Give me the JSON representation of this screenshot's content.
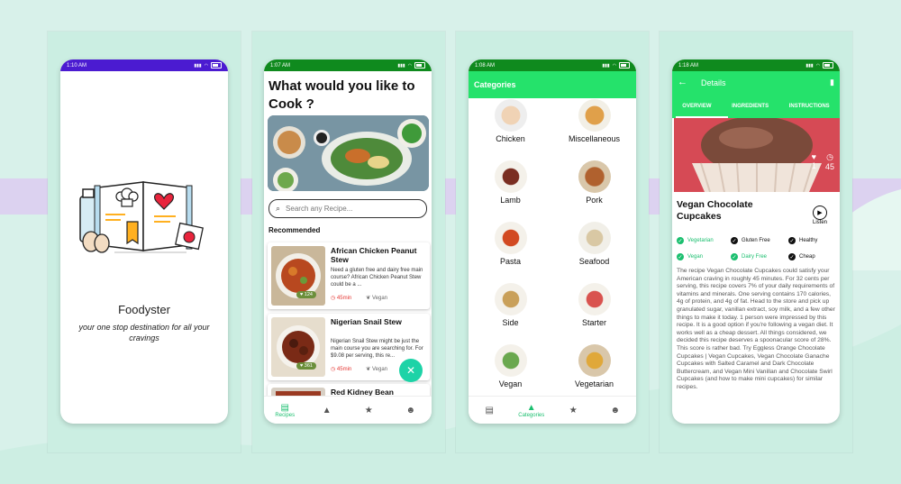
{
  "colors": {
    "background": "#d8f1ea",
    "accent_green": "#25e26b",
    "dark_green": "#0f8a1e",
    "splash_status": "#4b1bd1",
    "time_red": "#e53935"
  },
  "screens": {
    "splash": {
      "time": "1:10 AM",
      "app_name": "Foodyster",
      "tagline": "your one stop destination for all your cravings"
    },
    "home": {
      "time": "1:07 AM",
      "headline": "What would you like to Cook ?",
      "search_placeholder": "Search any Recipe...",
      "section_label": "Recommended",
      "recipes": [
        {
          "title": "African Chicken Peanut Stew",
          "desc": "Need a gluten free and dairy free main course? African Chicken Peanut Stew could be a ...",
          "likes": "124",
          "time": "45min",
          "diet": "Vegan"
        },
        {
          "title": "Nigerian Snail Stew",
          "desc": "Nigerian Snail Stew might be just the main course you are searching for. For $9.08 per serving, this re...",
          "likes": "361",
          "time": "45min",
          "diet": "Vegan"
        },
        {
          "title": "Red Kidney Bean"
        }
      ],
      "nav": [
        "Recipes",
        "",
        "",
        ""
      ]
    },
    "categories": {
      "time": "1:08 AM",
      "title": "Categories",
      "items": [
        "Chicken",
        "Miscellaneous",
        "Lamb",
        "Pork",
        "Pasta",
        "Seafood",
        "Side",
        "Starter",
        "Vegan",
        "Vegetarian"
      ],
      "nav": [
        "",
        "Categories",
        "",
        ""
      ]
    },
    "details": {
      "time": "1:18 AM",
      "title": "Details",
      "tabs": [
        "OVERVIEW",
        "INGREDIENTS",
        "INSTRUCTIONS"
      ],
      "likes": "1",
      "minutes": "45",
      "recipe_title": "Vegan Chocolate Cupcakes",
      "listen_label": "Listen",
      "tags": [
        {
          "label": "Vegetarian",
          "active": true
        },
        {
          "label": "Gluten Free",
          "active": false
        },
        {
          "label": "Healthy",
          "active": false
        },
        {
          "label": "Vegan",
          "active": true
        },
        {
          "label": "Dairy Free",
          "active": true
        },
        {
          "label": "Cheap",
          "active": false
        }
      ],
      "description": "The recipe Vegan Chocolate Cupcakes could satisfy your American craving in roughly 45 minutes. For 32 cents per serving, this recipe covers 7% of your daily requirements of vitamins and minerals. One serving contains 170 calories, 4g of protein, and 4g of fat. Head to the store and pick up granulated sugar, vanillan extract, soy milk, and a few other things to make it today. 1 person were impressed by this recipe. It is a good option if you're following a vegan diet. It works well as a cheap dessert. All things considered, we decided this recipe deserves a spoonacular score of 28%. This score is rather bad. Try Eggless Orange Chocolate Cupcakes | Vegan Cupcakes, Vegan Chocolate Ganache Cupcakes with Salted Caramel and Dark Chocolate Buttercream, and Vegan Mini Vanillan and Chocolate Swirl Cupcakes (and how to make mini cupcakes) for similar recipes."
    }
  }
}
